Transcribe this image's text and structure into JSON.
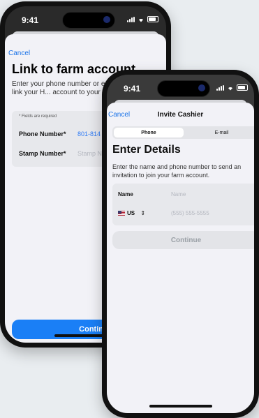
{
  "phone1": {
    "status": {
      "time": "9:41"
    },
    "cancel": "Cancel",
    "title": "Link to farm account",
    "description": "Enter your phone number or e... Stamp Number to link your H... account to your farm account",
    "fields_required": "* Fields are required",
    "fields": [
      {
        "label": "Phone Number*",
        "value": "801-814",
        "placeholder": ""
      },
      {
        "label": "Stamp Number*",
        "value": "",
        "placeholder": "Stamp N"
      }
    ],
    "continue": "Continue"
  },
  "phone2": {
    "status": {
      "time": "9:41"
    },
    "cancel": "Cancel",
    "nav_title": "Invite Cashier",
    "segments": [
      "Phone",
      "E-mail"
    ],
    "selected_segment": "Phone",
    "title": "Enter Details",
    "description": "Enter the name and phone number to send an invitation to join your farm account.",
    "name": {
      "label": "Name",
      "placeholder": "Name"
    },
    "phone": {
      "country": "US",
      "country_chevron": "⇕",
      "placeholder": "(555) 555-5555"
    },
    "continue": "Continue"
  },
  "colors": {
    "accent": "#1a7ff6",
    "background": "#e9edf0"
  }
}
